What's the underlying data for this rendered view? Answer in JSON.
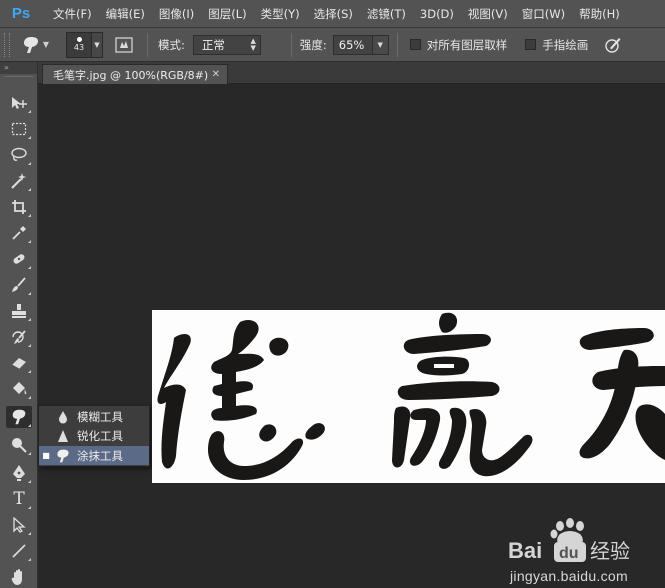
{
  "app": {
    "logo": "Ps"
  },
  "menu": [
    {
      "label": "文件(F)"
    },
    {
      "label": "编辑(E)"
    },
    {
      "label": "图像(I)"
    },
    {
      "label": "图层(L)"
    },
    {
      "label": "类型(Y)"
    },
    {
      "label": "选择(S)"
    },
    {
      "label": "滤镜(T)"
    },
    {
      "label": "3D(D)"
    },
    {
      "label": "视图(V)"
    },
    {
      "label": "窗口(W)"
    },
    {
      "label": "帮助(H)"
    }
  ],
  "options": {
    "brush_size": "43",
    "mode_label": "模式:",
    "mode_value": "正常",
    "strength_label": "强度:",
    "strength_value": "65%",
    "sample_all_label": "对所有图层取样",
    "finger_paint_label": "手指绘画",
    "sample_all_checked": false,
    "finger_paint_checked": false
  },
  "document": {
    "tab_title": "毛笔字.jpg @ 100%(RGB/8#)",
    "close_glyph": "✕"
  },
  "toolbox": {
    "top_glyph": "»",
    "tools": [
      "move-icon",
      "marquee-icon",
      "lasso-icon",
      "magic-wand-icon",
      "crop-icon",
      "eyedropper-icon",
      "healing-brush-icon",
      "brush-icon",
      "clone-stamp-icon",
      "history-brush-icon",
      "eraser-icon",
      "paint-bucket-icon",
      "smudge-icon",
      "dodge-icon",
      "pen-icon",
      "type-icon",
      "path-select-icon",
      "line-icon",
      "hand-icon"
    ],
    "type_tool_glyph": "T"
  },
  "flyout": {
    "items": [
      {
        "label": "模糊工具",
        "icon": "blur-drop-icon",
        "selected": false
      },
      {
        "label": "锐化工具",
        "icon": "sharpen-triangle-icon",
        "selected": false
      },
      {
        "label": "涂抹工具",
        "icon": "smudge-finger-icon",
        "selected": true
      }
    ],
    "bullet": "■"
  },
  "watermark": {
    "brand_text": "Bai",
    "brand_cn": "经验",
    "url": "jingyan.baidu.com"
  },
  "colors": {
    "panel": "#535353",
    "workspace": "#282828",
    "selection": "#5b6a86",
    "ink": "#1a1717"
  }
}
